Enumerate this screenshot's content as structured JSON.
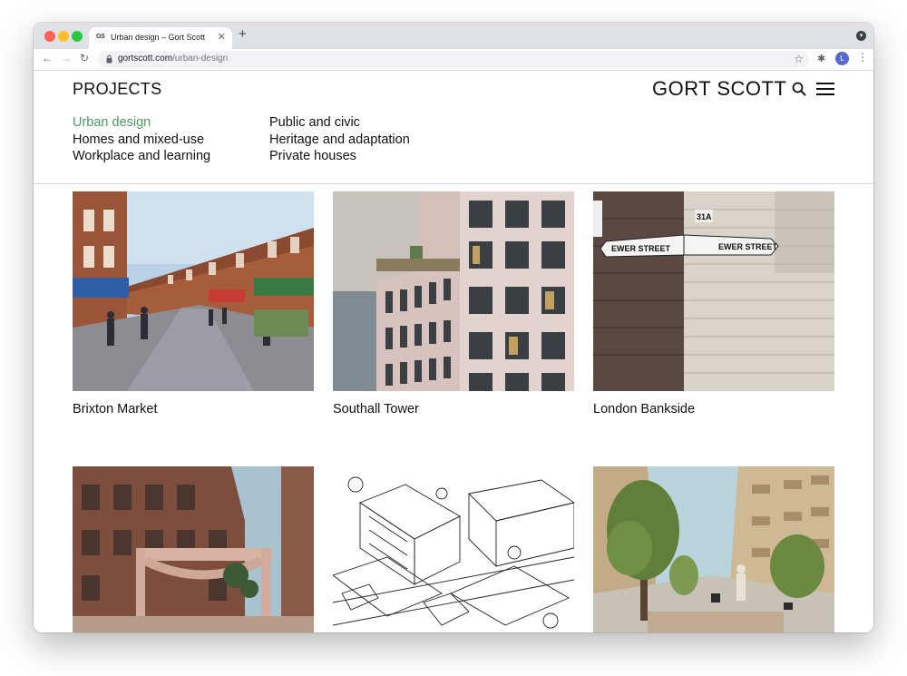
{
  "browser": {
    "tab_title": "Urban design – Gort Scott",
    "tab_favicon": "GS",
    "url_domain": "gortscott.com",
    "url_path": "/urban-design",
    "profile_initial": "L",
    "traffic_light_colors": [
      "#ff5f57",
      "#febc2e",
      "#28c840"
    ]
  },
  "site": {
    "section_title": "PROJECTS",
    "logo": "GORT SCOTT",
    "accent_color": "#4a9a62"
  },
  "categories": {
    "left": [
      "Urban design",
      "Homes and mixed-use",
      "Workplace and learning"
    ],
    "right": [
      "Public and civic",
      "Heritage and adaptation",
      "Private houses"
    ],
    "active": "Urban design"
  },
  "projects": [
    {
      "title": "Brixton Market"
    },
    {
      "title": "Southall Tower"
    },
    {
      "title": "London Bankside"
    },
    {
      "title": ""
    },
    {
      "title": ""
    },
    {
      "title": ""
    }
  ],
  "signage": {
    "left_sign": "EWER STREET",
    "right_sign": "EWER STREET",
    "number_plate": "31A"
  }
}
